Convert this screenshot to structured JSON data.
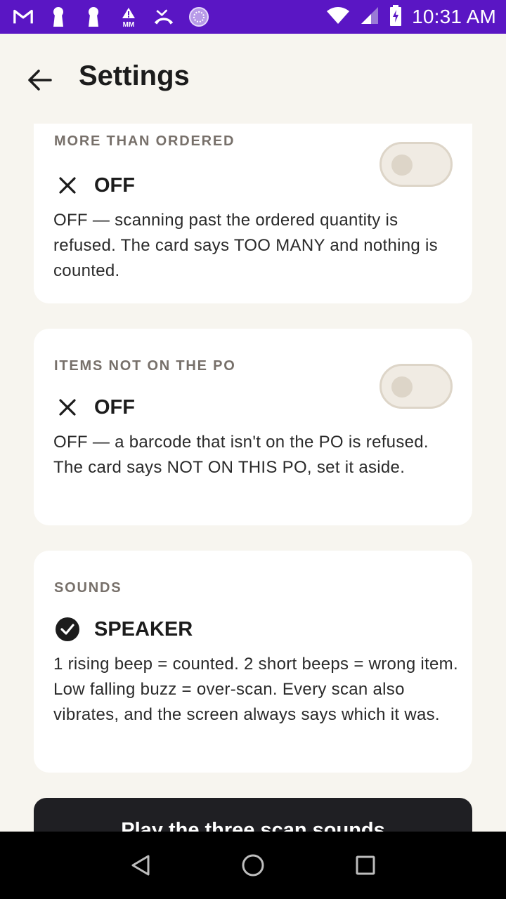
{
  "status_bar": {
    "time": "10:31 AM",
    "icons": [
      "gmail-icon",
      "keyhole-icon",
      "keyhole-icon",
      "warning-mm-icon",
      "missed-call-icon",
      "sync-circle-icon",
      "wifi-icon",
      "signal-icon",
      "battery-charging-icon"
    ],
    "mm_label": "MM"
  },
  "app_bar": {
    "title": "Settings",
    "back_icon": "arrow-left-icon"
  },
  "cards": [
    {
      "heading": "MORE THAN ORDERED",
      "state_icon": "close-icon",
      "state_label": "OFF",
      "toggle_on": false,
      "description": "OFF — scanning past the ordered quantity is refused. The card says TOO MANY and nothing is counted."
    },
    {
      "heading": "ITEMS NOT ON THE PO",
      "state_icon": "close-icon",
      "state_label": "OFF",
      "toggle_on": false,
      "description": "OFF — a barcode that isn't on the PO is refused. The card says NOT ON THIS PO, set it aside."
    },
    {
      "heading": "SOUNDS",
      "state_icon": "check-circle-icon",
      "state_label": "SPEAKER",
      "description": "1 rising beep = counted. 2 short beeps = wrong item. Low falling buzz = over-scan. Every scan also vibrates, and the screen always says which it was."
    }
  ],
  "play_button": {
    "label": "Play the three scan sounds"
  },
  "nav_bar": {
    "icons": [
      "nav-back-icon",
      "nav-home-icon",
      "nav-recents-icon"
    ]
  },
  "colors": {
    "status_bar": "#5a16c4",
    "background": "#f7f5ef",
    "card": "#ffffff",
    "heading": "#77706a",
    "toggle_track": "#f0ebe3",
    "toggle_knob": "#ddd5c8",
    "button": "#1f1f23"
  }
}
